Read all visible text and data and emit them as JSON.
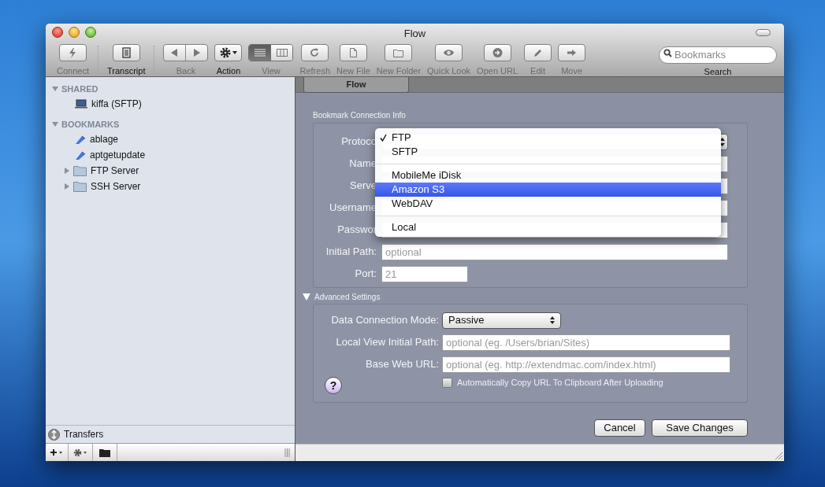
{
  "window": {
    "title": "Flow"
  },
  "toolbar": {
    "items": [
      {
        "kind": "connect",
        "label": "Connect",
        "enabled": false,
        "separator_after": true
      },
      {
        "kind": "transcript",
        "label": "Transcript",
        "enabled": true,
        "separator_after": true
      },
      {
        "kind": "back",
        "label": "Back",
        "enabled": false
      },
      {
        "kind": "action",
        "label": "Action",
        "enabled": true
      },
      {
        "kind": "view",
        "label": "View",
        "enabled": false,
        "segments": [
          {
            "selected": true
          },
          {
            "selected": false
          }
        ]
      },
      {
        "kind": "refresh",
        "label": "Refresh",
        "enabled": false
      },
      {
        "kind": "newfile",
        "label": "New File",
        "enabled": false
      },
      {
        "kind": "newfolder",
        "label": "New Folder",
        "enabled": false
      },
      {
        "kind": "quicklook",
        "label": "Quick Look",
        "enabled": false
      },
      {
        "kind": "openurl",
        "label": "Open URL",
        "enabled": false
      },
      {
        "kind": "edit",
        "label": "Edit",
        "enabled": false
      },
      {
        "kind": "move",
        "label": "Move",
        "enabled": false
      }
    ],
    "search": {
      "placeholder": "Bookmarks",
      "label": "Search"
    }
  },
  "sidebar": {
    "sections": [
      {
        "title": "SHARED",
        "expanded": true,
        "children": [
          {
            "kind": "server",
            "label": "kiffa (SFTP)"
          }
        ]
      },
      {
        "title": "BOOKMARKS",
        "expanded": true,
        "children": [
          {
            "kind": "bookmark",
            "label": "ablage"
          },
          {
            "kind": "bookmark",
            "label": "aptgetupdate"
          },
          {
            "kind": "folder",
            "label": "FTP Server",
            "expanded": false
          },
          {
            "kind": "folder",
            "label": "SSH Server",
            "expanded": false
          }
        ]
      }
    ],
    "transfers": "Transfers"
  },
  "tab": {
    "label": "Flow"
  },
  "connection_info": {
    "title": "Bookmark Connection Info",
    "fields": [
      {
        "kind": "popup",
        "label": "Protoco"
      },
      {
        "kind": "text",
        "label": "Name"
      },
      {
        "kind": "text",
        "label": "Serve"
      },
      {
        "kind": "text",
        "label": "Username"
      },
      {
        "kind": "text",
        "label": "Passwor"
      },
      {
        "kind": "text",
        "label": "Initial Path:",
        "placeholder": "optional"
      },
      {
        "kind": "short",
        "label": "Port:",
        "placeholder": "21"
      }
    ]
  },
  "protocol_menu": [
    {
      "kind": "item",
      "label": "FTP",
      "checked": true,
      "selected": false
    },
    {
      "kind": "item",
      "label": "SFTP",
      "checked": false,
      "selected": false
    },
    {
      "kind": "separator"
    },
    {
      "kind": "item",
      "label": "MobileMe iDisk",
      "checked": false,
      "selected": false
    },
    {
      "kind": "item",
      "label": "Amazon S3",
      "checked": false,
      "selected": true
    },
    {
      "kind": "item",
      "label": "WebDAV",
      "checked": false,
      "selected": false
    },
    {
      "kind": "separator"
    },
    {
      "kind": "item",
      "label": "Local",
      "checked": false,
      "selected": false
    }
  ],
  "advanced": {
    "title": "Advanced Settings",
    "expanded": true,
    "fields": [
      {
        "kind": "popup",
        "label": "Data Connection Mode:",
        "value": "Passive"
      },
      {
        "kind": "text",
        "label": "Local View Initial Path:",
        "placeholder": "optional (eg. /Users/brian/Sites)"
      },
      {
        "kind": "text",
        "label": "Base Web URL:",
        "placeholder": "optional (eg. http://extendmac.com/index.html)"
      }
    ],
    "help": "?",
    "checkbox": {
      "label": "Automatically Copy URL To Clipboard After Uploading",
      "checked": false
    }
  },
  "buttons": [
    "Cancel",
    "Save Changes"
  ]
}
